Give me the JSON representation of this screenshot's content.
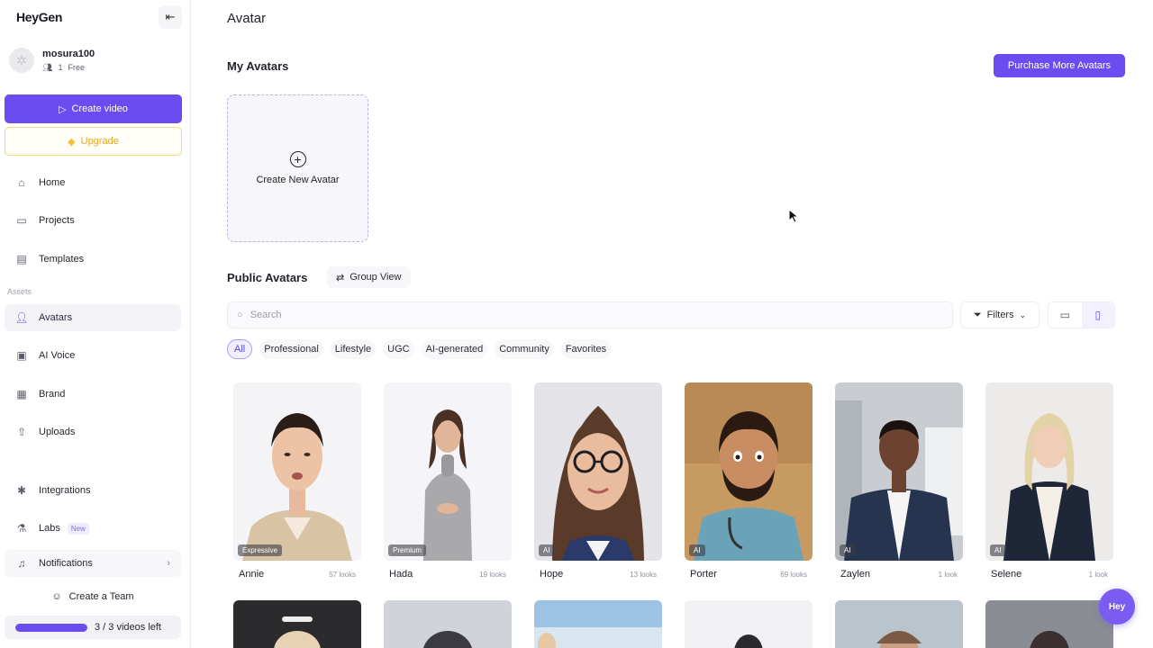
{
  "brand": {
    "logo": "HeyGen",
    "accent": "#6a4cf0"
  },
  "user": {
    "name": "mosura100",
    "seats": "1",
    "plan": "Free"
  },
  "sidebar": {
    "create_video": "Create video",
    "upgrade": "Upgrade",
    "assets_label": "Assets",
    "items": [
      {
        "label": "Home",
        "icon": "home-icon"
      },
      {
        "label": "Projects",
        "icon": "folder-icon"
      },
      {
        "label": "Templates",
        "icon": "film-icon"
      },
      {
        "label": "Avatars",
        "icon": "avatars-icon"
      },
      {
        "label": "AI Voice",
        "icon": "voice-icon"
      },
      {
        "label": "Brand",
        "icon": "brand-icon"
      },
      {
        "label": "Uploads",
        "icon": "upload-icon"
      },
      {
        "label": "Integrations",
        "icon": "gear-icon"
      },
      {
        "label": "Labs",
        "icon": "flask-icon",
        "badge": "New"
      },
      {
        "label": "Notifications",
        "icon": "bell-icon"
      }
    ],
    "create_team": "Create a Team",
    "videos_left": "3 / 3 videos left",
    "videos_used_fraction": 1.0
  },
  "main": {
    "page_title": "Avatar",
    "my_avatars_title": "My Avatars",
    "purchase_button": "Purchase More Avatars",
    "create_new_avatar": "Create New Avatar",
    "public_avatars_title": "Public Avatars",
    "group_view": "Group View",
    "search_placeholder": "Search",
    "filters": "Filters",
    "chips": [
      "All",
      "Professional",
      "Lifestyle",
      "UGC",
      "AI-generated",
      "Community",
      "Favorites"
    ],
    "avatars": [
      {
        "name": "Annie",
        "looks": "57 looks",
        "tag": "Expressive"
      },
      {
        "name": "Hada",
        "looks": "19 looks",
        "tag": "Premium"
      },
      {
        "name": "Hope",
        "looks": "13 looks",
        "tag": "AI"
      },
      {
        "name": "Porter",
        "looks": "69 looks",
        "tag": "AI"
      },
      {
        "name": "Zaylen",
        "looks": "1 look",
        "tag": "AI"
      },
      {
        "name": "Selene",
        "looks": "1 look",
        "tag": "AI"
      }
    ],
    "chat_bubble": "Hey"
  }
}
